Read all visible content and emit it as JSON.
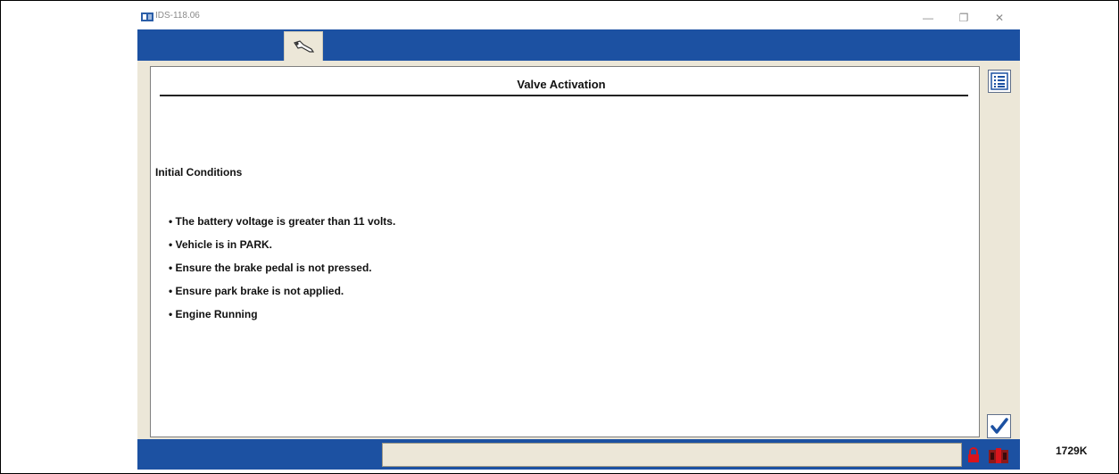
{
  "window": {
    "title": "IDS-118.06",
    "minimize_glyph": "—",
    "restore_glyph": "❐",
    "close_glyph": "✕"
  },
  "toolbar": {
    "active_tab_icon": "wrench-icon"
  },
  "panel": {
    "title": "Valve Activation",
    "heading": "Initial Conditions",
    "conditions": [
      "• The battery voltage is greater than 11 volts.",
      "• Vehicle is in PARK.",
      "• Ensure the brake pedal is not pressed.",
      "• Ensure park brake is not applied.",
      "• Engine Running"
    ]
  },
  "side_buttons": {
    "list_icon": "list-icon",
    "confirm_icon": "checkmark-icon"
  },
  "status": {
    "lock_icon": "padlock-icon",
    "connection_icon": "vehicle-connection-icon"
  },
  "figure_code": "1729K",
  "colors": {
    "chrome_blue": "#1c51a2",
    "panel_beige": "#ece7d8",
    "lock_red": "#d9141b"
  }
}
